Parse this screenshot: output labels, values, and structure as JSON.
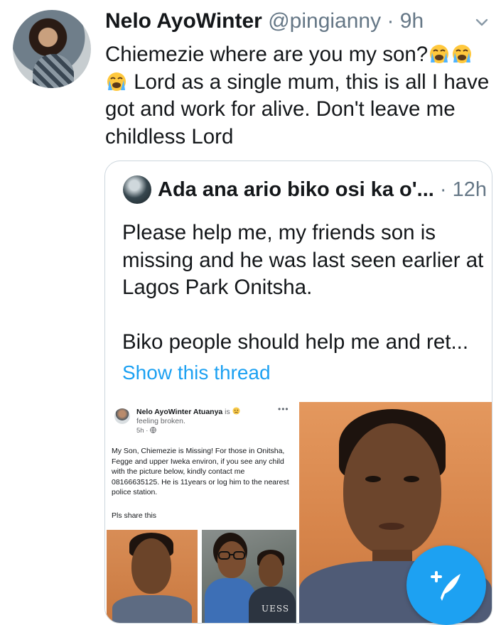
{
  "tweet": {
    "author_name": "Nelo AyoWinter",
    "handle": "@pingianny",
    "separator": " · ",
    "time": "9h",
    "text_line1": "Chiemezie where are you my son?",
    "text_rest": " Lord as a single mum, this is all I have got and work for alive. Don't leave me childless Lord",
    "emoji_icon": "loudly-crying-face-icon"
  },
  "quoted": {
    "author_name": "Ada ana ario biko osi ka o'...",
    "separator": " · ",
    "time": "12h",
    "text": "Please help me, my friends son is missing and he was last seen  earlier at Lagos Park Onitsha.\n\nBiko people should help me and ret...",
    "show_thread": "Show this thread"
  },
  "facebook_post": {
    "author": "Nelo AyoWinter Atuanya",
    "is_word": " is ",
    "feeling": "feeling broken.",
    "time": "5h · ",
    "body": "My Son, Chiemezie is Missing! For those in Onitsha, Fegge and upper Iweka environ, if you see any child with the picture below, kindly contact me 08166635125. He is 11years or log him to the nearest police station.",
    "share": "Pls share this",
    "more": "•••",
    "shirt_text": "UESS"
  },
  "colors": {
    "accent": "#1da1f2",
    "secondary_text": "#657786",
    "border": "#ccd6dd"
  },
  "fab": {
    "icon": "compose-tweet-icon"
  }
}
